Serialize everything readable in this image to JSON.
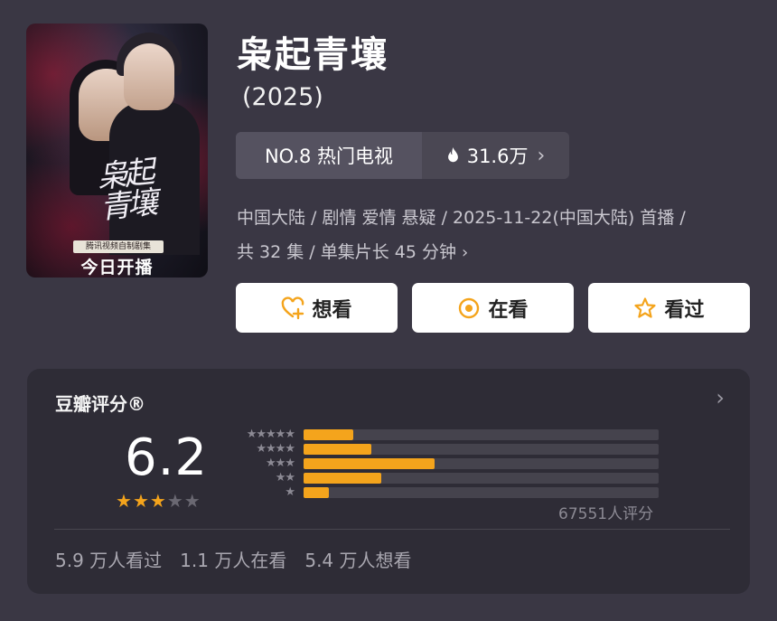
{
  "poster": {
    "calligraphy": "枭起青壤",
    "platform_tag": "腾讯视频自制剧集",
    "premiere_text": "今日开播"
  },
  "title": "枭起青壤",
  "year": "(2025)",
  "rank": {
    "label": "NO.8 热门电视",
    "heat": "31.6万"
  },
  "meta": {
    "line1": "中国大陆 / 剧情 爱情 悬疑 / 2025-11-22(中国大陆) 首播 /",
    "line2": "共 32 集 / 单集片长 45 分钟"
  },
  "actions": {
    "want": "想看",
    "watching": "在看",
    "watched": "看过"
  },
  "rating": {
    "label": "豆瓣评分®",
    "score": "6.2",
    "stars_filled": 3,
    "stars_total": 5,
    "distribution": [
      {
        "stars": "★★★★★",
        "fraction": 0.14
      },
      {
        "stars": "★★★★",
        "fraction": 0.19
      },
      {
        "stars": "★★★",
        "fraction": 0.37
      },
      {
        "stars": "★★",
        "fraction": 0.22
      },
      {
        "stars": "★",
        "fraction": 0.07
      }
    ],
    "count": "67551人评分",
    "stats": {
      "watched": "5.9 万人看过",
      "watching": "1.1 万人在看",
      "want": "5.4 万人想看"
    }
  },
  "colors": {
    "background": "#3a3744",
    "card": "#2e2c36",
    "accent": "#f4a41c",
    "text_muted": "#c9c7cf"
  }
}
